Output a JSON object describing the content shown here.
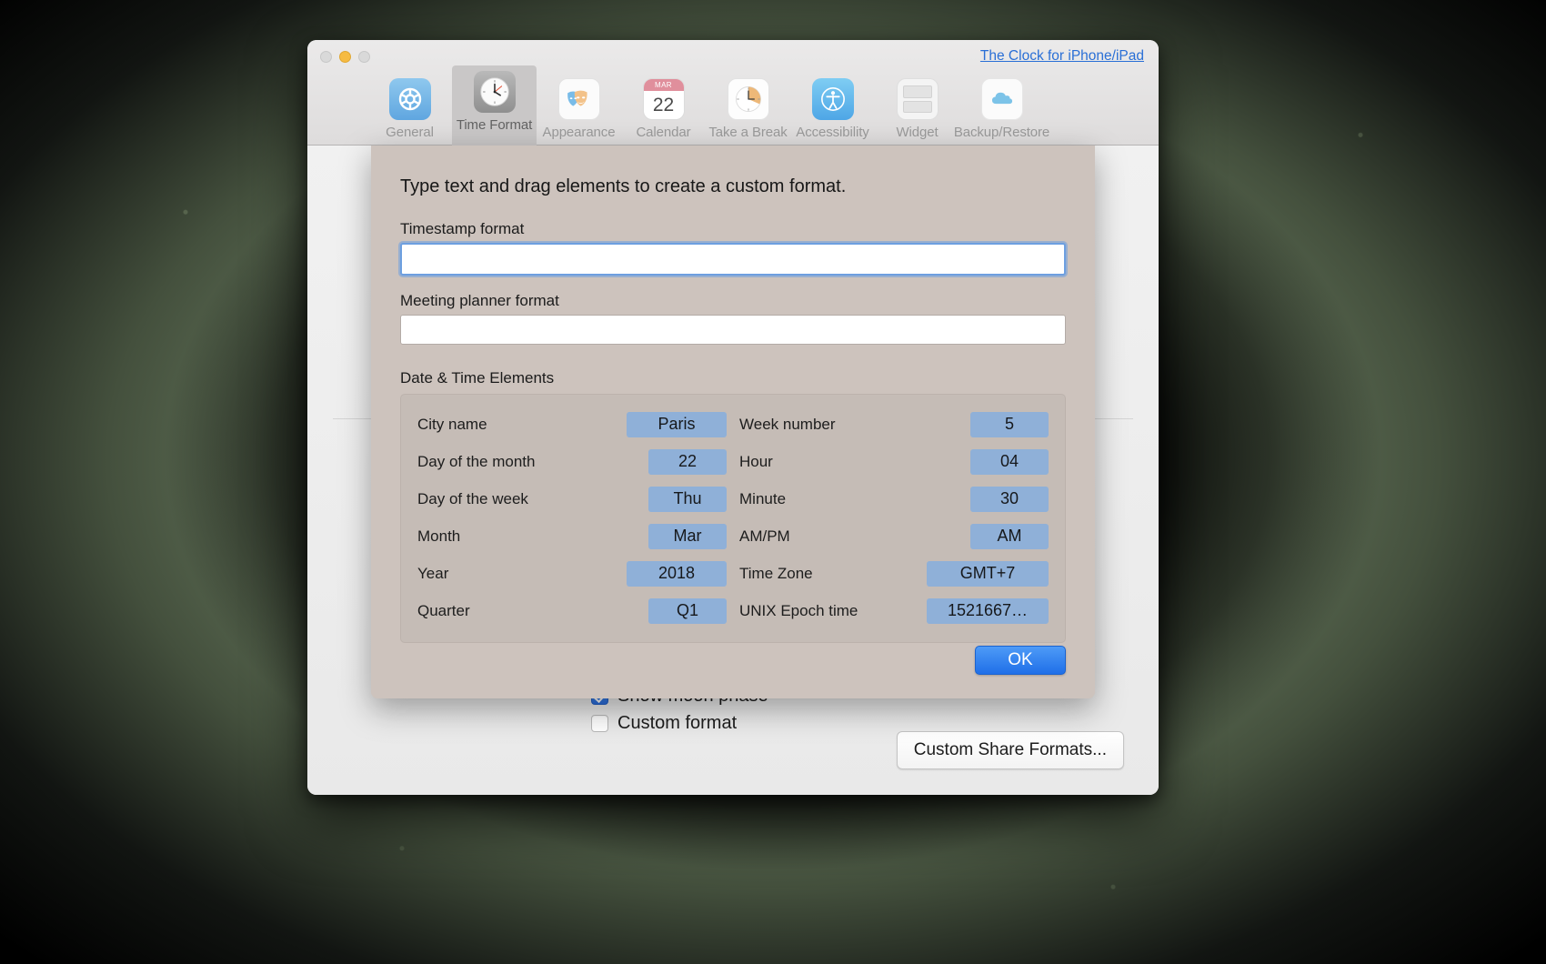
{
  "window": {
    "traffic_lights": [
      "close",
      "minimize",
      "zoom"
    ],
    "store_link": "The Clock for iPhone/iPad",
    "accent_blue": "#2a6fd6",
    "sheet_bg": "#cdc3bd",
    "token_blue": "#8fb0d8"
  },
  "toolbar": {
    "tabs": [
      {
        "label": "General",
        "icon": "gear-icon",
        "selected": false
      },
      {
        "label": "Time Format",
        "icon": "clock-icon",
        "selected": true
      },
      {
        "label": "Appearance",
        "icon": "theater-masks-icon",
        "selected": false
      },
      {
        "label": "Calendar",
        "icon": "calendar-icon",
        "selected": false
      },
      {
        "label": "Take a Break",
        "icon": "break-clock-icon",
        "selected": false
      },
      {
        "label": "Accessibility",
        "icon": "accessibility-icon",
        "selected": false
      },
      {
        "label": "Widget",
        "icon": "widget-icon",
        "selected": false
      },
      {
        "label": "Backup/Restore",
        "icon": "cloud-icon",
        "selected": false
      }
    ],
    "calendar_icon": {
      "month": "MAR",
      "day": "22"
    }
  },
  "sheet": {
    "title": "Type text and drag elements to create a custom format.",
    "timestamp_label": "Timestamp format",
    "timestamp_value": "",
    "timestamp_placeholder": "",
    "meeting_label": "Meeting planner format",
    "meeting_value": "",
    "meeting_placeholder": "",
    "elements_label": "Date & Time Elements",
    "elements_left": [
      {
        "name": "City name",
        "token": "Paris"
      },
      {
        "name": "Day of the month",
        "token": "22"
      },
      {
        "name": "Day of the week",
        "token": "Thu"
      },
      {
        "name": "Month",
        "token": "Mar"
      },
      {
        "name": "Year",
        "token": "2018"
      },
      {
        "name": "Quarter",
        "token": "Q1"
      }
    ],
    "elements_right": [
      {
        "name": "Week number",
        "token": "5"
      },
      {
        "name": "Hour",
        "token": "04"
      },
      {
        "name": "Minute",
        "token": "30"
      },
      {
        "name": "AM/PM",
        "token": "AM"
      },
      {
        "name": "Time Zone",
        "token": "GMT+7"
      },
      {
        "name": "UNIX Epoch time",
        "token": "1521667…"
      }
    ],
    "ok_label": "OK"
  },
  "background_panel": {
    "checkboxes": [
      {
        "label": "Show moon phase",
        "checked": true
      },
      {
        "label": "Custom format",
        "checked": false
      }
    ],
    "share_button": "Custom Share Formats..."
  }
}
